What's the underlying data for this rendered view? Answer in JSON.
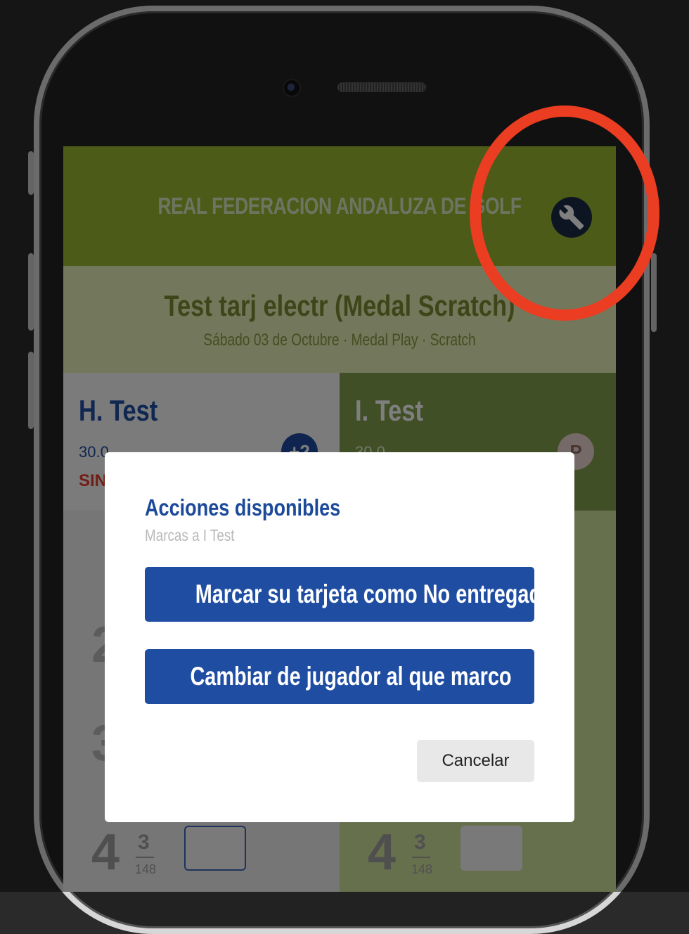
{
  "header": {
    "title": "REAL FEDERACION ANDALUZA DE GOLF",
    "wrench_icon": "wrench-icon"
  },
  "event": {
    "title": "Test tarj electr (Medal Scratch)",
    "subtitle": "Sábado 03 de Octubre · Medal Play · Scratch"
  },
  "players": [
    {
      "name": "H. Test",
      "handicap": "30.0",
      "status": "SIN",
      "badge": "+2"
    },
    {
      "name": "I. Test",
      "handicap": "30.0",
      "badge": "P"
    }
  ],
  "hole": {
    "number": "4",
    "par": "3",
    "meters": "148"
  },
  "modal": {
    "title": "Acciones disponibles",
    "subtitle": "Marcas a I Test",
    "actions": [
      "Marcar su tarjeta como No entregada",
      "Cambiar de jugador al que marco"
    ],
    "cancel_label": "Cancelar"
  },
  "colors": {
    "header_green": "#99b62e",
    "action_blue": "#1f4da1",
    "highlight_red": "#ea3d22"
  }
}
